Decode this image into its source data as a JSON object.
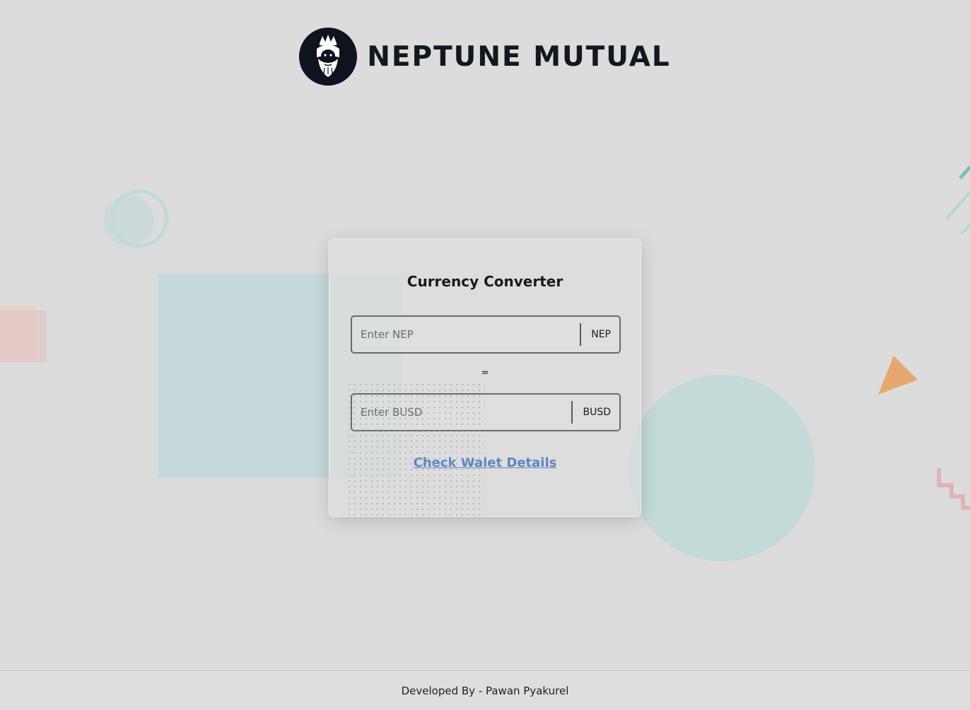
{
  "brand": {
    "name": "NEPTUNE MUTUAL",
    "logo_icon": "neptune-face-icon"
  },
  "converter": {
    "title": "Currency Converter",
    "nep_field": {
      "placeholder": "Enter NEP",
      "value": "",
      "unit": "NEP"
    },
    "equals_sign": "=",
    "busd_field": {
      "placeholder": "Enter BUSD",
      "value": "",
      "unit": "BUSD"
    },
    "wallet_link": "Check Walet Details"
  },
  "footer": {
    "credit": "Developed By - Pawan Pyakurel"
  },
  "colors": {
    "background": "#dcdcdc",
    "link": "#5b86c4",
    "logo_dark": "#0d1420",
    "teal_shape": "#c3d8d9",
    "orange_triangle": "#e6a870",
    "pink_shape": "#e3c5c6"
  }
}
